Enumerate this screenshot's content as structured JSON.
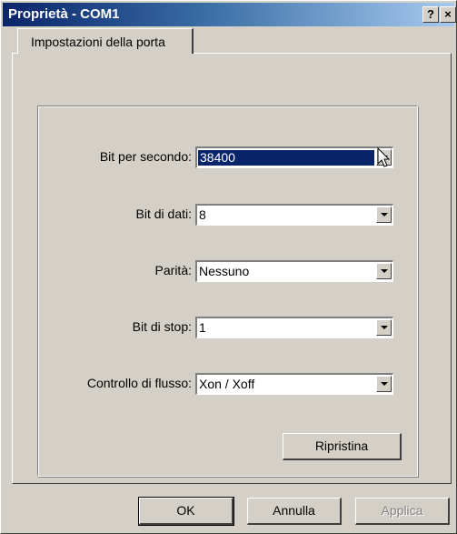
{
  "window": {
    "title": "Proprietà - COM1",
    "help_label": "?",
    "close_label": "×"
  },
  "tab": {
    "label": "Impostazioni della porta"
  },
  "fields": [
    {
      "label": "Bit per secondo:",
      "value": "38400",
      "selected": true
    },
    {
      "label": "Bit di dati:",
      "value": "8",
      "selected": false
    },
    {
      "label": "Parità:",
      "value": "Nessuno",
      "selected": false
    },
    {
      "label": "Bit di stop:",
      "value": "1",
      "selected": false
    },
    {
      "label": "Controllo di flusso:",
      "value": "Xon / Xoff",
      "selected": false
    }
  ],
  "buttons": {
    "restore_label": "Ripristina",
    "ok_label": "OK",
    "cancel_label": "Annulla",
    "apply_label": "Applica"
  },
  "colors": {
    "title_bar_start": "#0a246a",
    "selection": "#0a246a",
    "face": "#d4d0c8"
  }
}
